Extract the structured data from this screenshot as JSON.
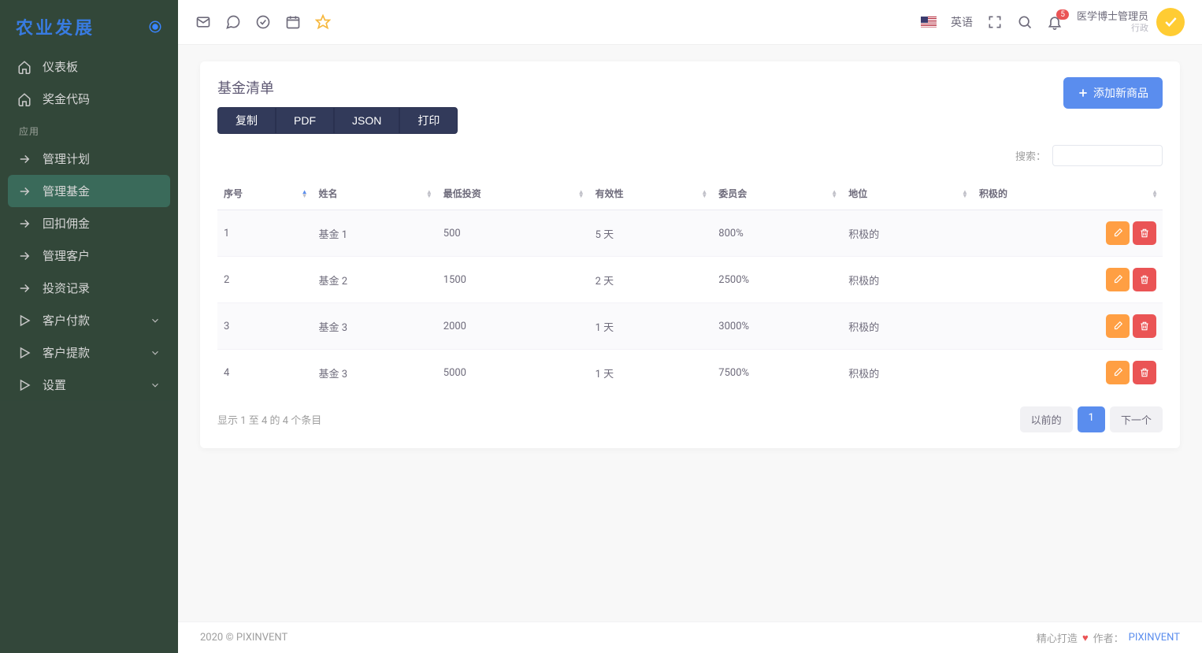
{
  "brand": "农业发展",
  "sidebar": {
    "items": [
      {
        "icon": "home",
        "label": "仪表板"
      },
      {
        "icon": "home",
        "label": "奖金代码"
      }
    ],
    "section_label": "应用",
    "app_items": [
      {
        "icon": "arrow",
        "label": "管理计划",
        "chev": false
      },
      {
        "icon": "arrow",
        "label": "管理基金",
        "chev": false,
        "active": true
      },
      {
        "icon": "arrow",
        "label": "回扣佣金",
        "chev": false
      },
      {
        "icon": "arrow",
        "label": "管理客户",
        "chev": false
      },
      {
        "icon": "arrow",
        "label": "投资记录",
        "chev": false
      },
      {
        "icon": "play",
        "label": "客户付款",
        "chev": true
      },
      {
        "icon": "play",
        "label": "客户提款",
        "chev": true
      },
      {
        "icon": "play",
        "label": "设置",
        "chev": true
      }
    ]
  },
  "topbar": {
    "language": "英语",
    "notifications_count": "5",
    "user_name": "医学博士管理员",
    "user_role": "行政"
  },
  "card": {
    "title": "基金清单",
    "add_label": "添加新商品",
    "exports": [
      "复制",
      "PDF",
      "JSON",
      "打印"
    ],
    "search_label": "搜索：",
    "columns": [
      "序号",
      "姓名",
      "最低投资",
      "有效性",
      "委员会",
      "地位",
      "积极的"
    ],
    "rows": [
      {
        "n": "1",
        "name": "基金 1",
        "min": "500",
        "valid": "5 天",
        "comm": "800%",
        "status": "积极的"
      },
      {
        "n": "2",
        "name": "基金 2",
        "min": "1500",
        "valid": "2 天",
        "comm": "2500%",
        "status": "积极的"
      },
      {
        "n": "3",
        "name": "基金 3",
        "min": "2000",
        "valid": "1 天",
        "comm": "3000%",
        "status": "积极的"
      },
      {
        "n": "4",
        "name": "基金 3",
        "min": "5000",
        "valid": "1 天",
        "comm": "7500%",
        "status": "积极的"
      }
    ],
    "info": "显示 1 至 4 的 4 个条目",
    "pager": {
      "prev": "以前的",
      "page": "1",
      "next": "下一个"
    }
  },
  "footer": {
    "left": "2020 © PIXINVENT",
    "made": "精心打造",
    "by_label": "作者：",
    "by": "PIXINVENT"
  }
}
